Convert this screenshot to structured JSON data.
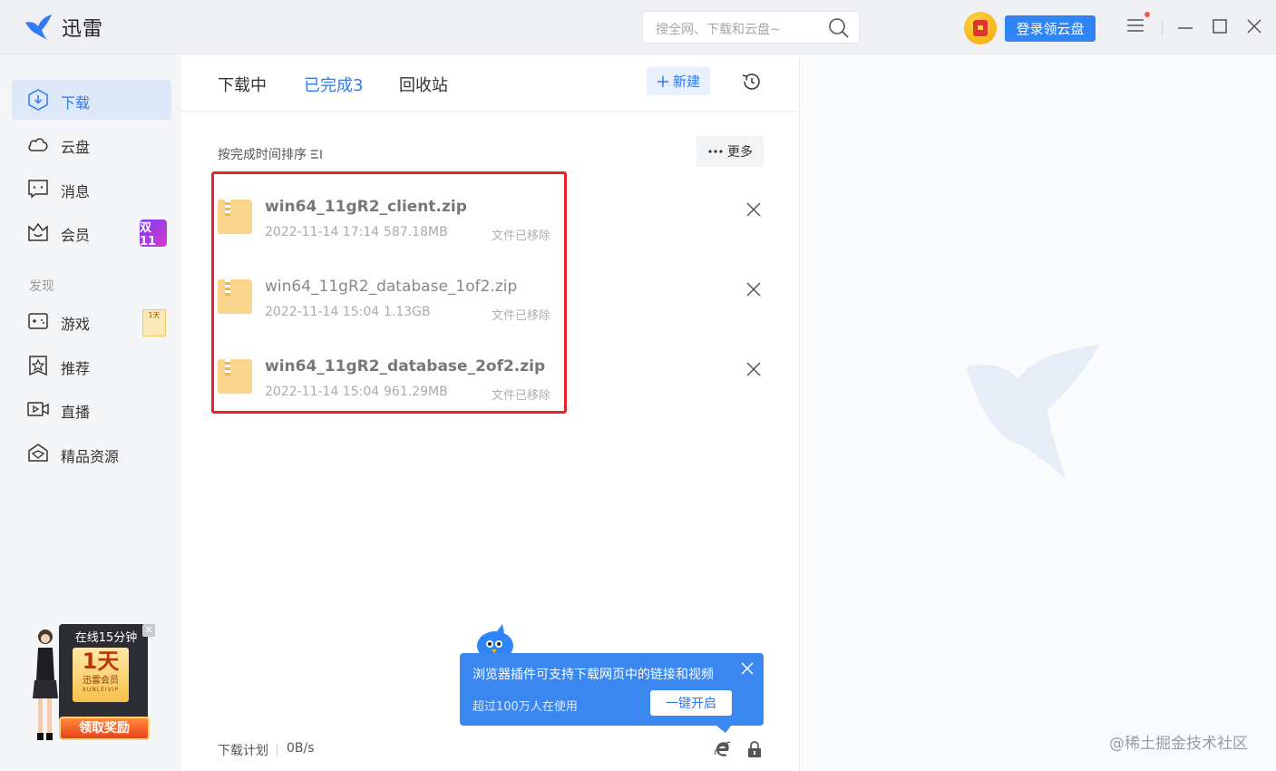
{
  "app": {
    "title": "迅雷"
  },
  "search": {
    "placeholder": "搜全网、下载和云盘~"
  },
  "header": {
    "login_label": "登录领云盘"
  },
  "sidebar": {
    "items": [
      {
        "label": "下载"
      },
      {
        "label": "云盘"
      },
      {
        "label": "消息"
      },
      {
        "label": "会员",
        "badge": "双11"
      },
      {
        "label": "游戏",
        "badge": "1天"
      },
      {
        "label": "推荐"
      },
      {
        "label": "直播"
      },
      {
        "label": "精品资源"
      }
    ],
    "section_label": "发现"
  },
  "promo": {
    "top": "在线15分钟",
    "day": "1天",
    "name": "迅雷会员",
    "name_en": "XUNLEIVIP",
    "button": "领取奖励"
  },
  "tabs": [
    {
      "label": "下载中"
    },
    {
      "label": "已完成3"
    },
    {
      "label": "回收站"
    }
  ],
  "toolbar": {
    "new_label": "新建",
    "more_label": "更多",
    "sort_label": "按完成时间排序"
  },
  "files": [
    {
      "name": "win64_11gR2_client.zip",
      "date": "2022-11-14 17:14",
      "size": "587.18MB",
      "status": "文件已移除"
    },
    {
      "name": "win64_11gR2_database_1of2.zip",
      "date": "2022-11-14 15:04",
      "size": "1.13GB",
      "status": "文件已移除"
    },
    {
      "name": "win64_11gR2_database_2of2.zip",
      "date": "2022-11-14 15:04",
      "size": "961.29MB",
      "status": "文件已移除"
    }
  ],
  "tooltip": {
    "title": "浏览器插件可支持下载网页中的链接和视频",
    "subtitle": "超过100万人在使用",
    "button": "一键开启"
  },
  "footer": {
    "plan_label": "下载计划",
    "speed": "0B/s"
  },
  "watermark": "@稀土掘金技术社区",
  "colors": {
    "accent": "#2f7af0",
    "highlight": "#e8242a"
  }
}
